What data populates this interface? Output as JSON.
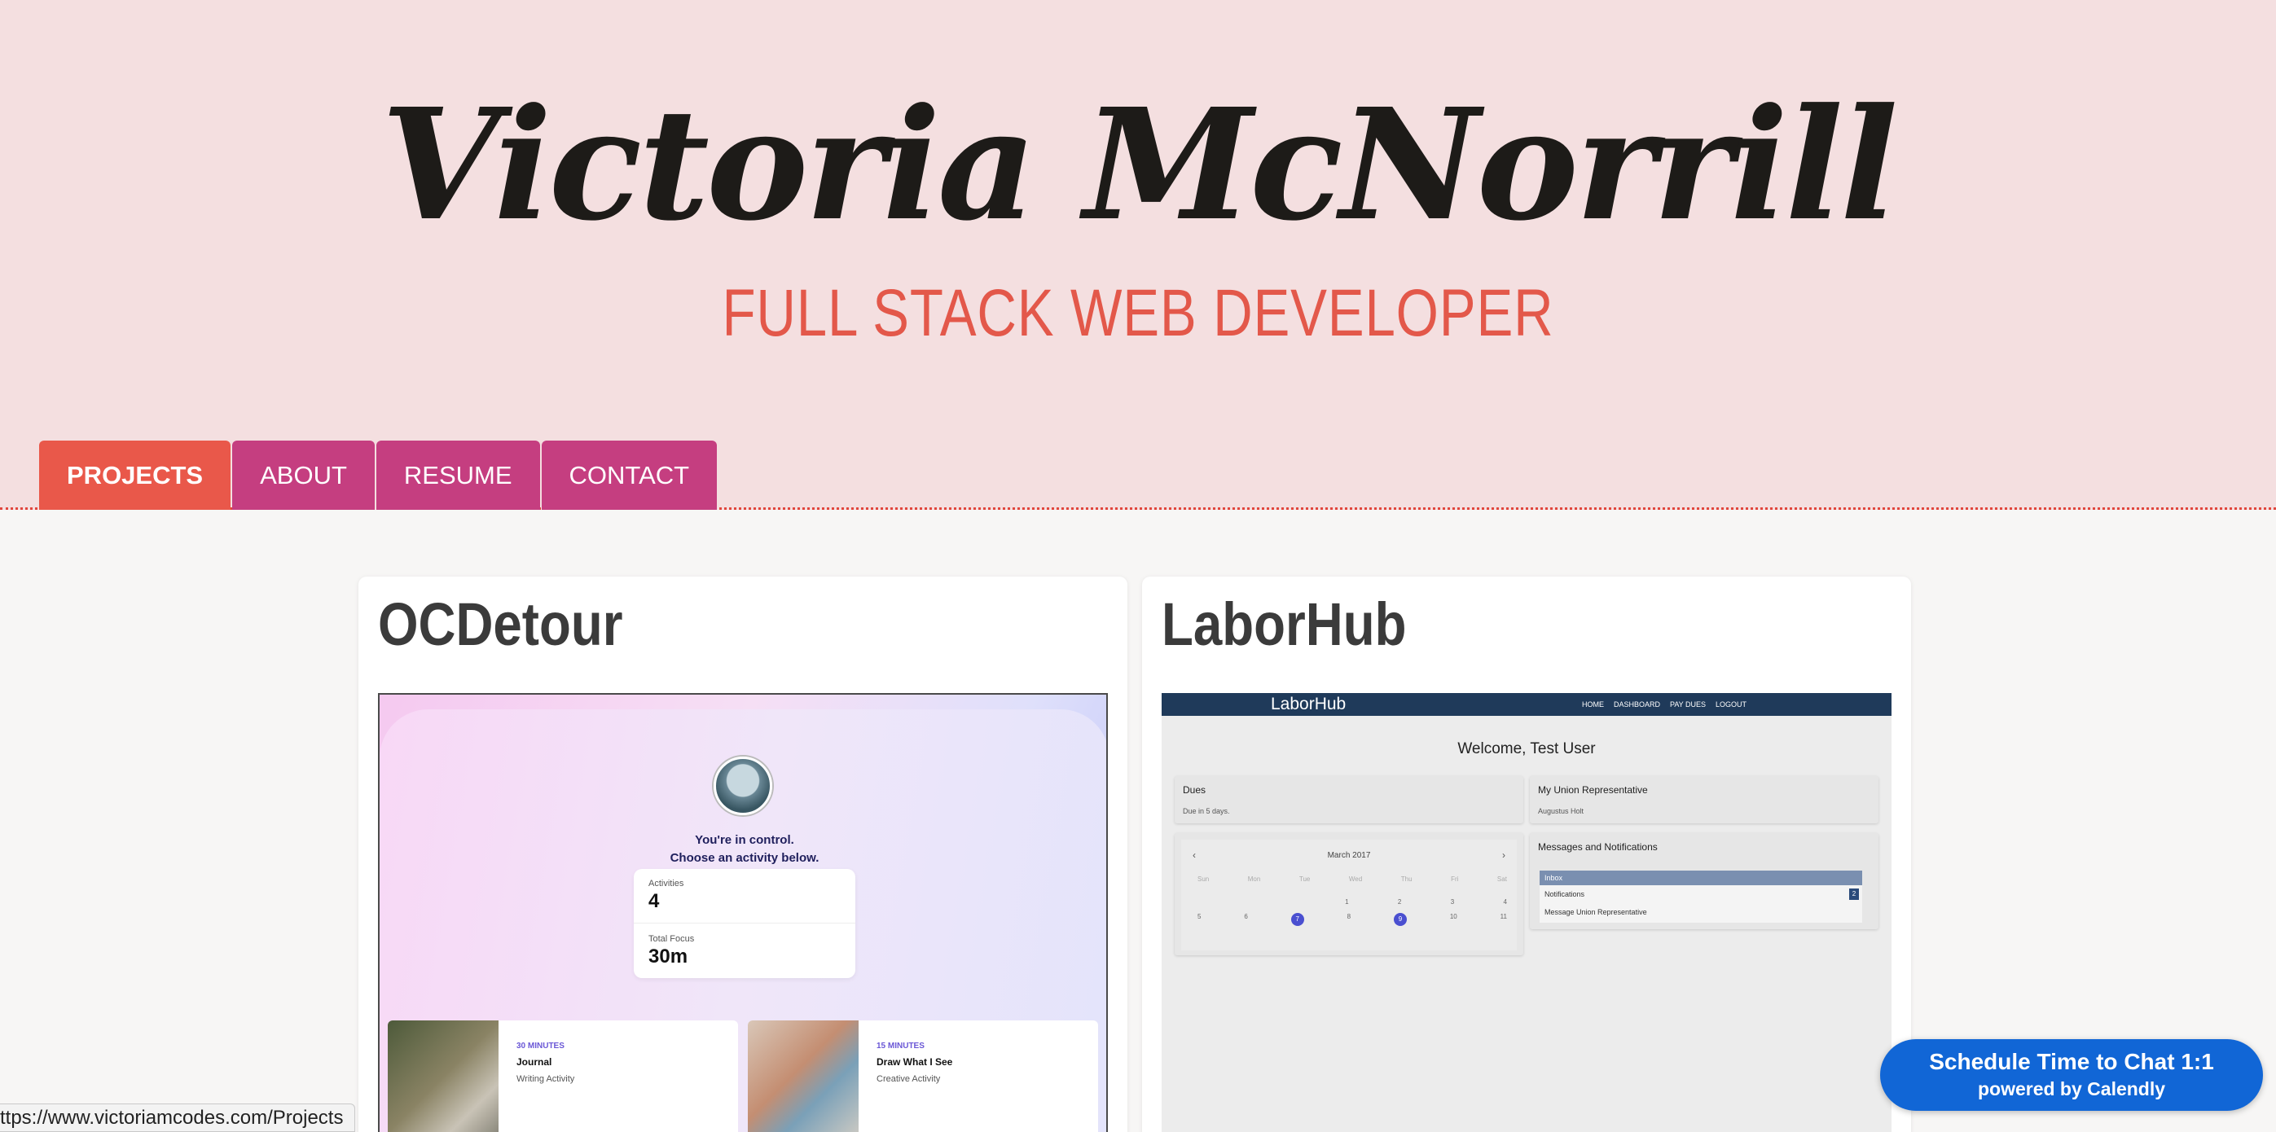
{
  "header": {
    "name": "Victoria McNorrill",
    "subtitle": "FULL STACK WEB DEVELOPER"
  },
  "nav": {
    "tabs": [
      {
        "label": "PROJECTS",
        "active": true
      },
      {
        "label": "ABOUT",
        "active": false
      },
      {
        "label": "RESUME",
        "active": false
      },
      {
        "label": "CONTACT",
        "active": false
      }
    ]
  },
  "projects": [
    {
      "title": "OCDetour",
      "preview": {
        "line1": "You're in control.",
        "line2": "Choose an activity below.",
        "stats": [
          {
            "label": "Activities",
            "value": "4"
          },
          {
            "label": "Total Focus",
            "value": "30m"
          }
        ],
        "activities": [
          {
            "time": "30 MINUTES",
            "name": "Journal",
            "type": "Writing Activity"
          },
          {
            "time": "15 MINUTES",
            "name": "Draw What I See",
            "type": "Creative Activity"
          }
        ]
      }
    },
    {
      "title": "LaborHub",
      "preview": {
        "brand": "LaborHub",
        "nav": [
          "HOME",
          "DASHBOARD",
          "PAY DUES",
          "LOGOUT"
        ],
        "welcome": "Welcome, Test User",
        "dues_title": "Dues",
        "dues_sub": "Due in 5 days.",
        "rep_title": "My Union Representative",
        "rep_name": "Augustus Holt",
        "calendar_month": "March 2017",
        "calendar_days": [
          "Sun",
          "Mon",
          "Tue",
          "Wed",
          "Thu",
          "Fri",
          "Sat"
        ],
        "messages_title": "Messages and Notifications",
        "messages": [
          "Inbox",
          "Notifications",
          "Message Union Representative"
        ],
        "notification_count": "2"
      }
    }
  ],
  "status_bar": {
    "url": "ttps://www.victoriamcodes.com/Projects"
  },
  "calendly": {
    "line1": "Schedule Time to Chat 1:1",
    "line2": "powered by Calendly",
    "color": "#1166d6"
  },
  "colors": {
    "accent": "#e9584a",
    "tab": "#c53e80",
    "header_bg": "#f4dfe0"
  }
}
